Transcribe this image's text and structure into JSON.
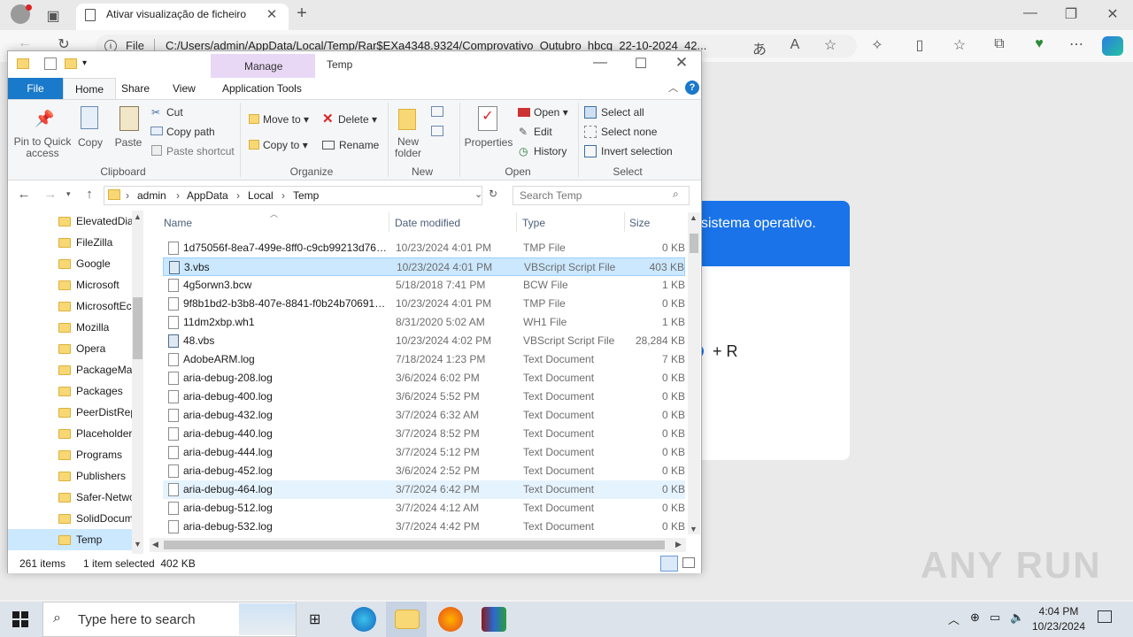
{
  "edge": {
    "tab_title": "Ativar visualização de ficheiro",
    "file_label": "File",
    "address": "C:/Users/admin/AppData/Local/Temp/Rar$EXa4348.9324/Comprovativo_Outubro_hbcq_22-10-2024_42...",
    "page_text": "sistema operativo.",
    "plus_r": "+ R"
  },
  "explorer": {
    "title": "Temp",
    "manage_label": "Manage",
    "tabs": [
      "File",
      "Home",
      "Share",
      "View",
      "Application Tools"
    ],
    "clipboard": {
      "pin": "Pin to Quick access",
      "copy": "Copy",
      "paste": "Paste",
      "cut": "Cut",
      "copy_path": "Copy path",
      "paste_shortcut": "Paste shortcut",
      "group": "Clipboard"
    },
    "organize": {
      "move_to": "Move to",
      "copy_to": "Copy to",
      "delete": "Delete",
      "rename": "Rename",
      "group": "Organize"
    },
    "new": {
      "new_folder": "New folder",
      "group": "New"
    },
    "open": {
      "properties": "Properties",
      "open": "Open",
      "edit": "Edit",
      "history": "History",
      "group": "Open"
    },
    "select": {
      "select_all": "Select all",
      "select_none": "Select none",
      "invert": "Invert selection",
      "group": "Select"
    },
    "breadcrumb": [
      "admin",
      "AppData",
      "Local",
      "Temp"
    ],
    "search_placeholder": "Search Temp",
    "columns": {
      "name": "Name",
      "date": "Date modified",
      "type": "Type",
      "size": "Size"
    },
    "nav_items": [
      "ElevatedDia",
      "FileZilla",
      "Google",
      "Microsoft",
      "MicrosoftEc",
      "Mozilla",
      "Opera",
      "PackageMa",
      "Packages",
      "PeerDistRep",
      "Placeholder",
      "Programs",
      "Publishers",
      "Safer-Netwo",
      "SolidDocum",
      "Temp"
    ],
    "files": [
      {
        "name": "1d75056f-8ea7-499e-8ff0-c9cb99213d76.t...",
        "date": "10/23/2024 4:01 PM",
        "type": "TMP File",
        "size": "0 KB"
      },
      {
        "name": "3.vbs",
        "date": "10/23/2024 4:01 PM",
        "type": "VBScript Script File",
        "size": "403 KB"
      },
      {
        "name": "4g5orwn3.bcw",
        "date": "5/18/2018 7:41 PM",
        "type": "BCW File",
        "size": "1 KB"
      },
      {
        "name": "9f8b1bd2-b3b8-407e-8841-f0b24b70691a...",
        "date": "10/23/2024 4:01 PM",
        "type": "TMP File",
        "size": "0 KB"
      },
      {
        "name": "11dm2xbp.wh1",
        "date": "8/31/2020 5:02 AM",
        "type": "WH1 File",
        "size": "1 KB"
      },
      {
        "name": "48.vbs",
        "date": "10/23/2024 4:02 PM",
        "type": "VBScript Script File",
        "size": "28,284 KB"
      },
      {
        "name": "AdobeARM.log",
        "date": "7/18/2024 1:23 PM",
        "type": "Text Document",
        "size": "7 KB"
      },
      {
        "name": "aria-debug-208.log",
        "date": "3/6/2024 6:02 PM",
        "type": "Text Document",
        "size": "0 KB"
      },
      {
        "name": "aria-debug-400.log",
        "date": "3/6/2024 5:52 PM",
        "type": "Text Document",
        "size": "0 KB"
      },
      {
        "name": "aria-debug-432.log",
        "date": "3/7/2024 6:32 AM",
        "type": "Text Document",
        "size": "0 KB"
      },
      {
        "name": "aria-debug-440.log",
        "date": "3/7/2024 8:52 PM",
        "type": "Text Document",
        "size": "0 KB"
      },
      {
        "name": "aria-debug-444.log",
        "date": "3/7/2024 5:12 PM",
        "type": "Text Document",
        "size": "0 KB"
      },
      {
        "name": "aria-debug-452.log",
        "date": "3/6/2024 2:52 PM",
        "type": "Text Document",
        "size": "0 KB"
      },
      {
        "name": "aria-debug-464.log",
        "date": "3/7/2024 6:42 PM",
        "type": "Text Document",
        "size": "0 KB"
      },
      {
        "name": "aria-debug-512.log",
        "date": "3/7/2024 4:12 AM",
        "type": "Text Document",
        "size": "0 KB"
      },
      {
        "name": "aria-debug-532.log",
        "date": "3/7/2024 4:42 PM",
        "type": "Text Document",
        "size": "0 KB"
      }
    ],
    "selected_file": "3.vbs",
    "hovered_file": "aria-debug-464.log",
    "status_count": "261 items",
    "status_selected": "1 item selected  402 KB"
  },
  "taskbar": {
    "search_placeholder": "Type here to search",
    "time": "4:04 PM",
    "date": "10/23/2024"
  },
  "watermark": "ANY RUN"
}
